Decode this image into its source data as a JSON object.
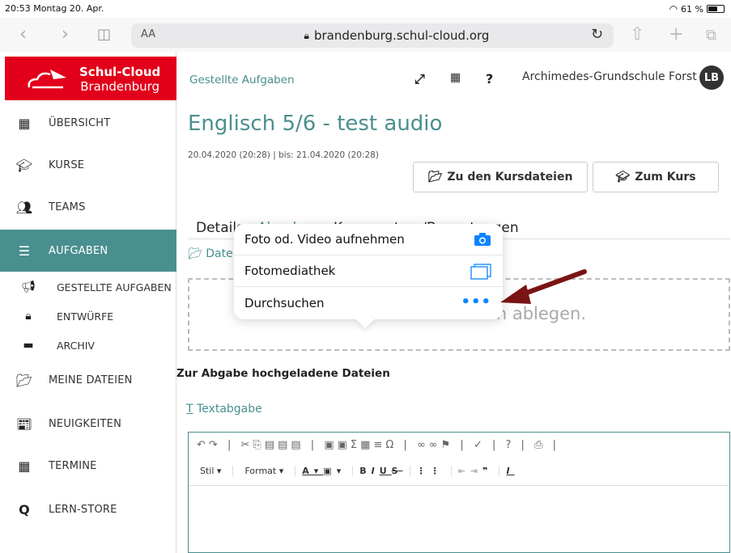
{
  "status": {
    "time_date": "20:53  Montag 20. Apr.",
    "battery": "61 %",
    "battery_level": 0.61
  },
  "browser": {
    "text_size": "AA",
    "url": "brandenburg.schul-cloud.org"
  },
  "brand": {
    "line1": "Schul-Cloud",
    "line2": "Brandenburg",
    "color": "#e2001a"
  },
  "sidebar": {
    "items": [
      {
        "label": "ÜBERSICHT",
        "icon": "dashboard-icon"
      },
      {
        "label": "KURSE",
        "icon": "graduation-cap-icon"
      },
      {
        "label": "TEAMS",
        "icon": "team-icon"
      },
      {
        "label": "AUFGABEN",
        "icon": "tasks-icon"
      },
      {
        "label": "MEINE DATEIEN",
        "icon": "folder-icon"
      },
      {
        "label": "NEUIGKEITEN",
        "icon": "news-icon"
      },
      {
        "label": "TERMINE",
        "icon": "calendar-icon"
      },
      {
        "label": "LERN-STORE",
        "icon": "search-icon"
      }
    ],
    "subitems": [
      {
        "label": "GESTELLTE AUFGABEN",
        "icon": "megaphone-icon"
      },
      {
        "label": "ENTWÜRFE",
        "icon": "lock-icon"
      },
      {
        "label": "ARCHIV",
        "icon": "archive-icon"
      }
    ],
    "active_color": "#4a8f8f"
  },
  "header": {
    "breadcrumb": "Gestellte Aufgaben",
    "help": "?",
    "school": "Archimedes-Grundschule Forst",
    "avatar": "LB"
  },
  "task": {
    "title": "Englisch 5/6 - test audio",
    "dates": "20.04.2020 (20:28) | bis: 21.04.2020 (20:28)",
    "btn_files": "Zu den Kursdateien",
    "btn_course": "Zum Kurs"
  },
  "tabs": {
    "details": "Details",
    "abgabe": "Abgabe",
    "kommentare": "Kommentare/Bewertungen"
  },
  "files_label": "Dateien",
  "dropzone_text": "Dateien zum Hochladen ablegen.",
  "uploaded_label": "Zur Abgabe hochgeladene Dateien",
  "textabgabe": "Textabgabe",
  "editor": {
    "style": "Stil",
    "format": "Format"
  },
  "popover": {
    "items": [
      {
        "label": "Foto od. Video aufnehmen",
        "icon": "camera-icon"
      },
      {
        "label": "Fotomediathek",
        "icon": "photo-library-icon"
      },
      {
        "label": "Durchsuchen",
        "icon": "more-icon"
      }
    ]
  }
}
